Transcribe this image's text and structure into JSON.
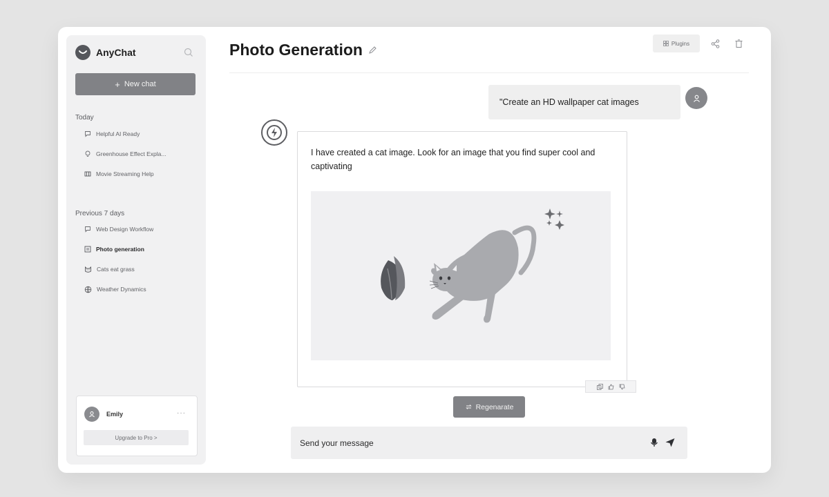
{
  "app": {
    "name": "AnyChat"
  },
  "sidebar": {
    "new_chat_label": "New chat",
    "sections": [
      {
        "label": "Today",
        "items": [
          {
            "label": "Helpful AI Ready",
            "icon": "chat-bubble-icon"
          },
          {
            "label": "Greenhouse Effect Expla...",
            "icon": "lightbulb-icon"
          },
          {
            "label": "Movie Streaming Help",
            "icon": "film-icon"
          }
        ]
      },
      {
        "label": "Previous 7 days",
        "items": [
          {
            "label": "Web Design Workflow",
            "icon": "chat-bubble-icon"
          },
          {
            "label": "Photo generation",
            "icon": "image-icon",
            "active": true
          },
          {
            "label": "Cats eat grass",
            "icon": "cat-icon"
          },
          {
            "label": "Weather Dynamics",
            "icon": "globe-icon"
          }
        ]
      }
    ],
    "user": {
      "name": "Emily",
      "more": "···",
      "upgrade_label": "Upgrade to Pro >"
    }
  },
  "header": {
    "title": "Photo Generation",
    "plugins_label": "Plugins"
  },
  "conversation": {
    "user_message": "\"Create an HD wallpaper cat images",
    "assistant_message": "I have created a cat image. Look for an image that you find super cool and captivating"
  },
  "actions": {
    "regenerate_label": "Regenarate"
  },
  "composer": {
    "placeholder": "Send your message"
  },
  "colors": {
    "accent": "#818286",
    "sidebar_bg": "#f1f1f2",
    "background": "#e4e4e4"
  }
}
